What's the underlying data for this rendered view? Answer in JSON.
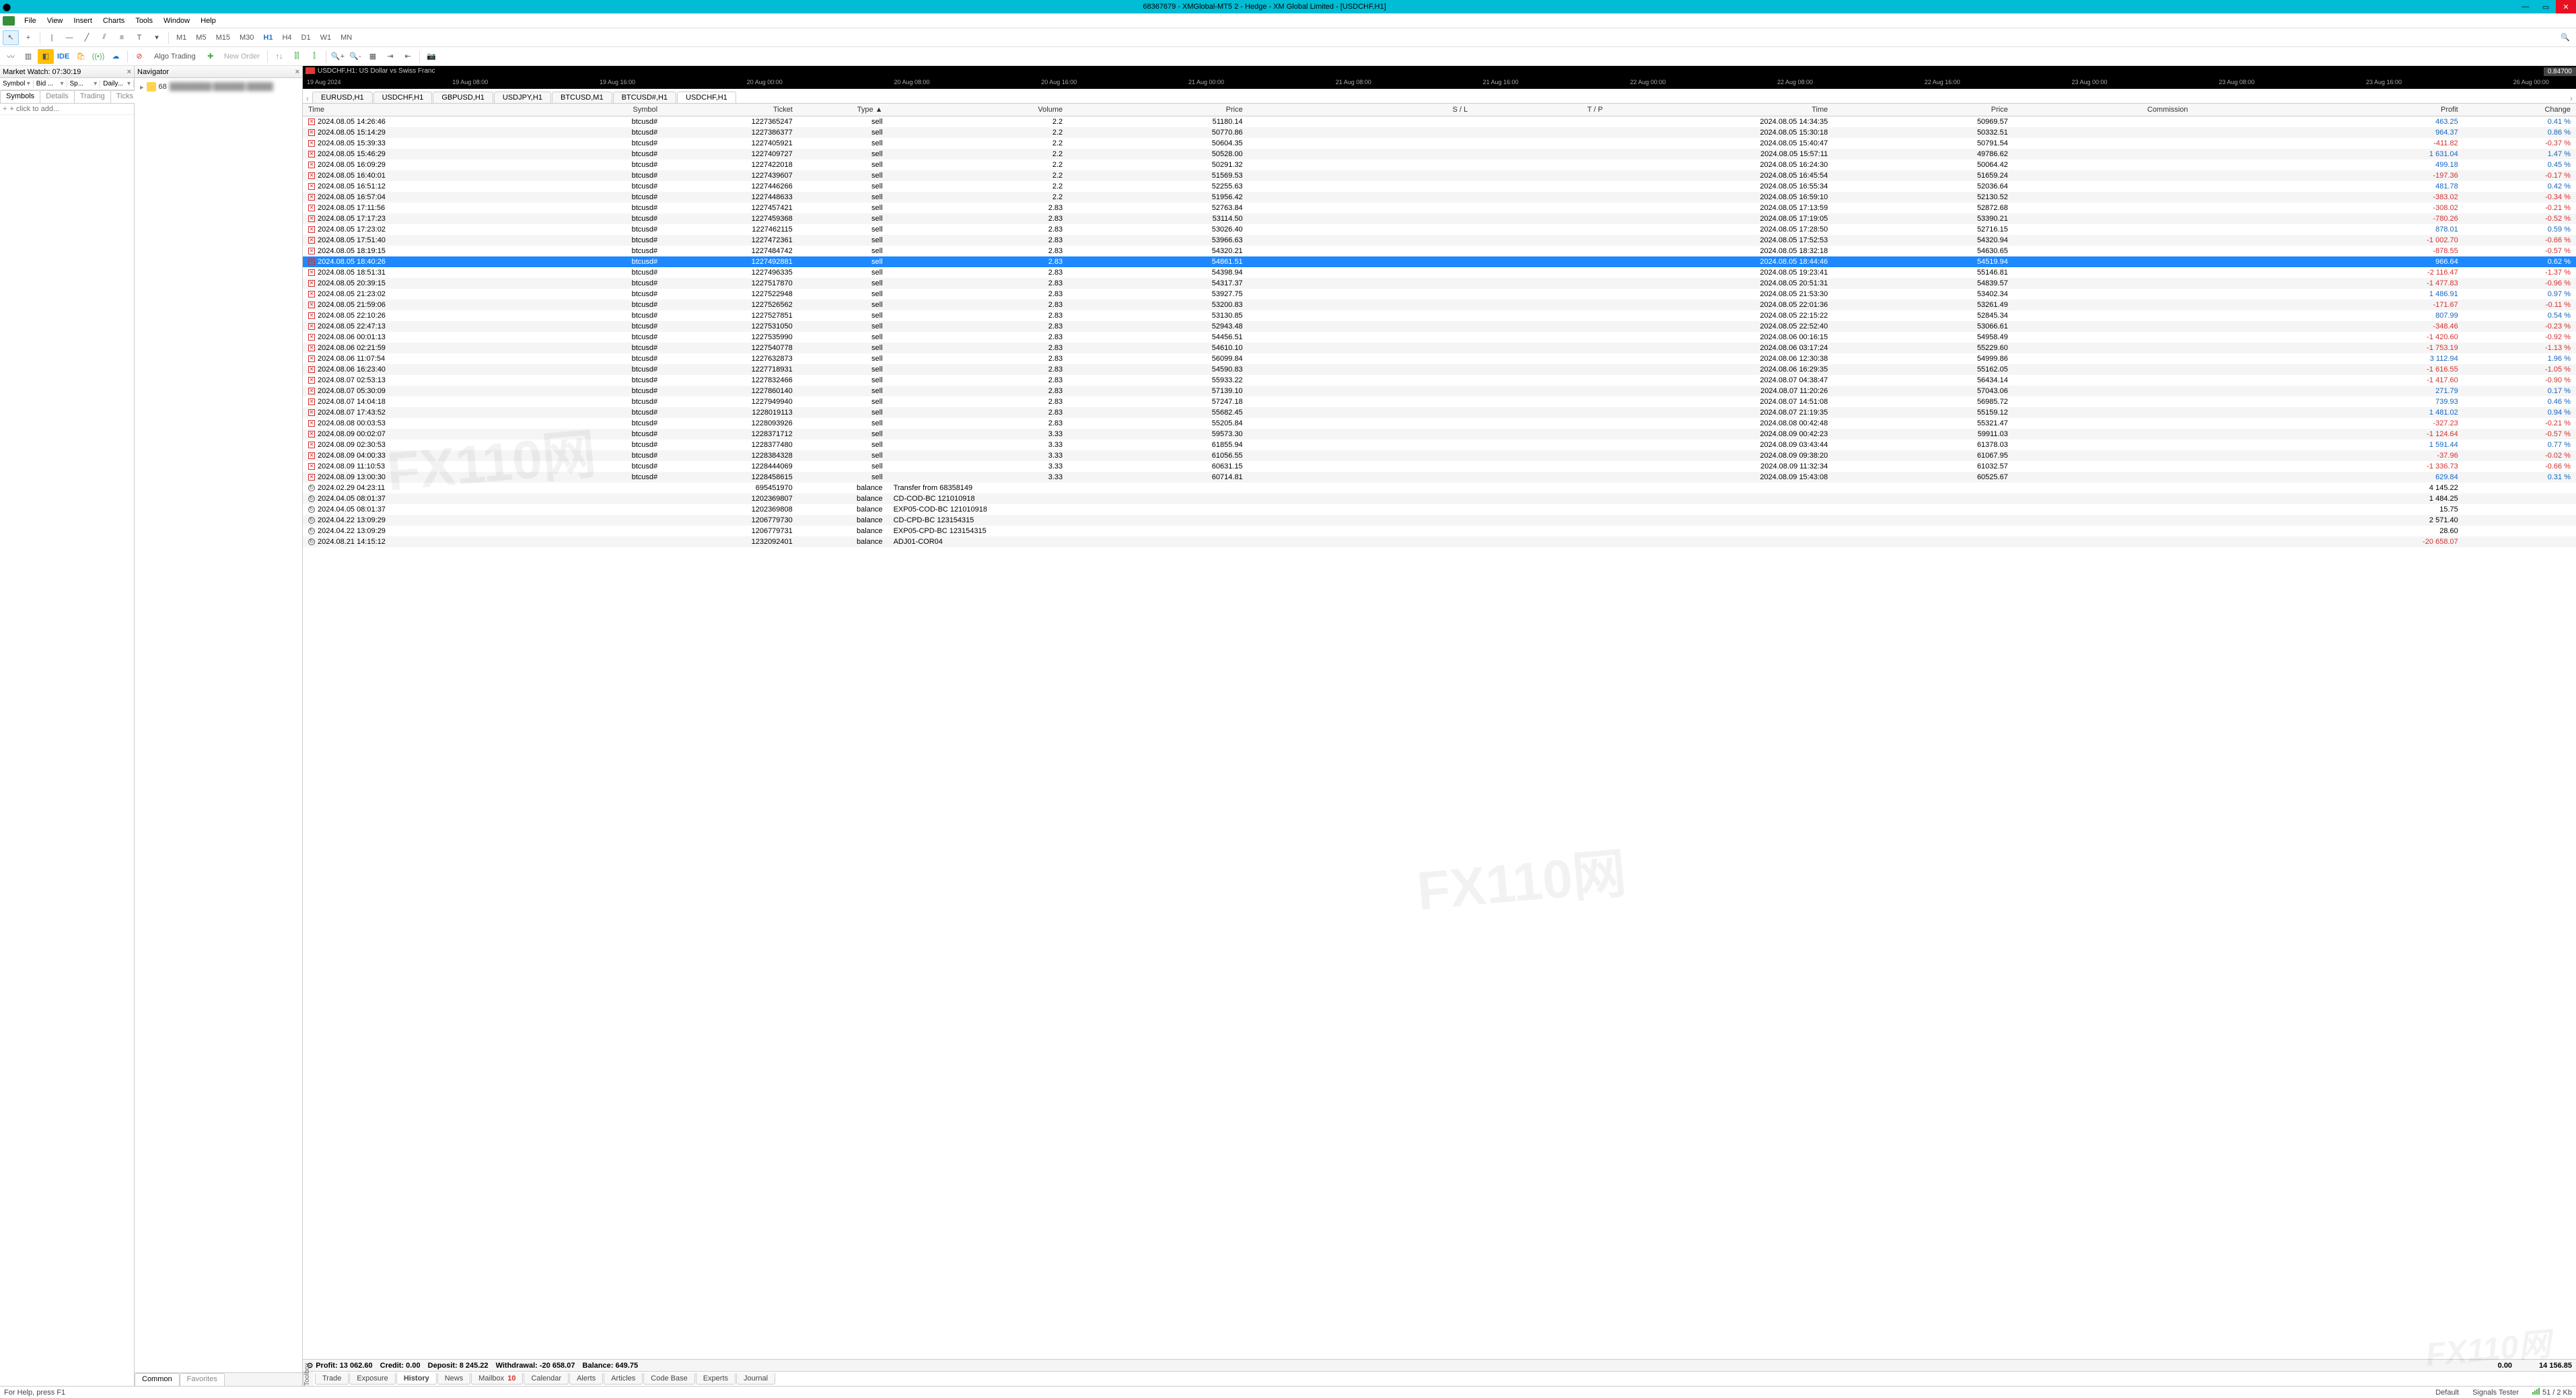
{
  "title": "68367679 - XMGlobal-MT5 2 - Hedge - XM Global Limited - [USDCHF,H1]",
  "menu": [
    "File",
    "View",
    "Insert",
    "Charts",
    "Tools",
    "Window",
    "Help"
  ],
  "timeframes": [
    "M1",
    "M5",
    "M15",
    "M30",
    "H1",
    "H4",
    "D1",
    "W1",
    "MN"
  ],
  "tf_active": "H1",
  "toolbar2": {
    "algo": "Algo Trading",
    "neworder": "New Order"
  },
  "market_watch": {
    "title": "Market Watch: 07:30:19",
    "filter_labels": [
      "Symbol",
      "Bid ...",
      "Sp...",
      "Daily..."
    ],
    "tabs": [
      "Symbols",
      "Details",
      "Trading",
      "Ticks"
    ],
    "search_placeholder": "+ click to add..."
  },
  "navigator": {
    "title": "Navigator",
    "account_id": "68",
    "account_name_masked": "████████ ██████ █████",
    "tabs": [
      "Common",
      "Favorites"
    ]
  },
  "chart": {
    "label": "USDCHF,H1: US Dollar vs Swiss Franc",
    "price": "0.84700",
    "ticks": [
      "19 Aug 2024",
      "19 Aug 08:00",
      "19 Aug 16:00",
      "20 Aug 00:00",
      "20 Aug 08:00",
      "20 Aug 16:00",
      "21 Aug 00:00",
      "21 Aug 08:00",
      "21 Aug 16:00",
      "22 Aug 00:00",
      "22 Aug 08:00",
      "22 Aug 16:00",
      "23 Aug 00:00",
      "23 Aug 08:00",
      "23 Aug 16:00",
      "26 Aug 00:00"
    ],
    "tabs": [
      "EURUSD,H1",
      "USDCHF,H1",
      "GBPUSD,H1",
      "USDJPY,H1",
      "BTCUSD,M1",
      "BTCUSD#,H1",
      "USDCHF,H1"
    ],
    "active_idx": 6
  },
  "headers": [
    "Time",
    "Symbol",
    "Ticket",
    "Type  ▲",
    "Volume",
    "Price",
    "S / L",
    "T / P",
    "Time",
    "Price",
    "Commission",
    "Profit",
    "Change"
  ],
  "rows": [
    {
      "t": "2024.08.05 14:26:46",
      "s": "btcusd#",
      "tk": "1227365247",
      "ty": "sell",
      "v": "2.2",
      "p": "51180.14",
      "sl": "",
      "tp": "",
      "t2": "2024.08.05 14:34:35",
      "p2": "50969.57",
      "c": "",
      "pr": "463.25",
      "ch": "0.41 %",
      "pc": "pos",
      "cc": "pos"
    },
    {
      "t": "2024.08.05 15:14:29",
      "s": "btcusd#",
      "tk": "1227386377",
      "ty": "sell",
      "v": "2.2",
      "p": "50770.86",
      "sl": "",
      "tp": "",
      "t2": "2024.08.05 15:30:18",
      "p2": "50332.51",
      "c": "",
      "pr": "964.37",
      "ch": "0.86 %",
      "pc": "pos",
      "cc": "pos"
    },
    {
      "t": "2024.08.05 15:39:33",
      "s": "btcusd#",
      "tk": "1227405921",
      "ty": "sell",
      "v": "2.2",
      "p": "50604.35",
      "sl": "",
      "tp": "",
      "t2": "2024.08.05 15:40:47",
      "p2": "50791.54",
      "c": "",
      "pr": "-411.82",
      "ch": "-0.37 %",
      "pc": "neg",
      "cc": "neg"
    },
    {
      "t": "2024.08.05 15:46:29",
      "s": "btcusd#",
      "tk": "1227409727",
      "ty": "sell",
      "v": "2.2",
      "p": "50528.00",
      "sl": "",
      "tp": "",
      "t2": "2024.08.05 15:57:11",
      "p2": "49786.62",
      "c": "",
      "pr": "1 631.04",
      "ch": "1.47 %",
      "pc": "pos",
      "cc": "pos"
    },
    {
      "t": "2024.08.05 16:09:29",
      "s": "btcusd#",
      "tk": "1227422018",
      "ty": "sell",
      "v": "2.2",
      "p": "50291.32",
      "sl": "",
      "tp": "",
      "t2": "2024.08.05 16:24:30",
      "p2": "50064.42",
      "c": "",
      "pr": "499.18",
      "ch": "0.45 %",
      "pc": "pos",
      "cc": "pos"
    },
    {
      "t": "2024.08.05 16:40:01",
      "s": "btcusd#",
      "tk": "1227439607",
      "ty": "sell",
      "v": "2.2",
      "p": "51569.53",
      "sl": "",
      "tp": "",
      "t2": "2024.08.05 16:45:54",
      "p2": "51659.24",
      "c": "",
      "pr": "-197.36",
      "ch": "-0.17 %",
      "pc": "neg",
      "cc": "neg"
    },
    {
      "t": "2024.08.05 16:51:12",
      "s": "btcusd#",
      "tk": "1227446266",
      "ty": "sell",
      "v": "2.2",
      "p": "52255.63",
      "sl": "",
      "tp": "",
      "t2": "2024.08.05 16:55:34",
      "p2": "52036.64",
      "c": "",
      "pr": "481.78",
      "ch": "0.42 %",
      "pc": "pos",
      "cc": "pos"
    },
    {
      "t": "2024.08.05 16:57:04",
      "s": "btcusd#",
      "tk": "1227448633",
      "ty": "sell",
      "v": "2.2",
      "p": "51956.42",
      "sl": "",
      "tp": "",
      "t2": "2024.08.05 16:59:10",
      "p2": "52130.52",
      "c": "",
      "pr": "-383.02",
      "ch": "-0.34 %",
      "pc": "neg",
      "cc": "neg"
    },
    {
      "t": "2024.08.05 17:11:56",
      "s": "btcusd#",
      "tk": "1227457421",
      "ty": "sell",
      "v": "2.83",
      "p": "52763.84",
      "sl": "",
      "tp": "",
      "t2": "2024.08.05 17:13:59",
      "p2": "52872.68",
      "c": "",
      "pr": "-308.02",
      "ch": "-0.21 %",
      "pc": "neg",
      "cc": "neg"
    },
    {
      "t": "2024.08.05 17:17:23",
      "s": "btcusd#",
      "tk": "1227459368",
      "ty": "sell",
      "v": "2.83",
      "p": "53114.50",
      "sl": "",
      "tp": "",
      "t2": "2024.08.05 17:19:05",
      "p2": "53390.21",
      "c": "",
      "pr": "-780.26",
      "ch": "-0.52 %",
      "pc": "neg",
      "cc": "neg"
    },
    {
      "t": "2024.08.05 17:23:02",
      "s": "btcusd#",
      "tk": "1227462115",
      "ty": "sell",
      "v": "2.83",
      "p": "53026.40",
      "sl": "",
      "tp": "",
      "t2": "2024.08.05 17:28:50",
      "p2": "52716.15",
      "c": "",
      "pr": "878.01",
      "ch": "0.59 %",
      "pc": "pos",
      "cc": "pos"
    },
    {
      "t": "2024.08.05 17:51:40",
      "s": "btcusd#",
      "tk": "1227472361",
      "ty": "sell",
      "v": "2.83",
      "p": "53966.63",
      "sl": "",
      "tp": "",
      "t2": "2024.08.05 17:52:53",
      "p2": "54320.94",
      "c": "",
      "pr": "-1 002.70",
      "ch": "-0.66 %",
      "pc": "neg",
      "cc": "neg"
    },
    {
      "t": "2024.08.05 18:19:15",
      "s": "btcusd#",
      "tk": "1227484742",
      "ty": "sell",
      "v": "2.83",
      "p": "54320.21",
      "sl": "",
      "tp": "",
      "t2": "2024.08.05 18:32:18",
      "p2": "54630.65",
      "c": "",
      "pr": "-878.55",
      "ch": "-0.57 %",
      "pc": "neg",
      "cc": "neg"
    },
    {
      "t": "2024.08.05 18:40:26",
      "s": "btcusd#",
      "tk": "1227492881",
      "ty": "sell",
      "v": "2.83",
      "p": "54861.51",
      "sl": "",
      "tp": "",
      "t2": "2024.08.05 18:44:46",
      "p2": "54519.94",
      "c": "",
      "pr": "966.64",
      "ch": "0.62 %",
      "pc": "pos",
      "cc": "pos",
      "sel": true
    },
    {
      "t": "2024.08.05 18:51:31",
      "s": "btcusd#",
      "tk": "1227496335",
      "ty": "sell",
      "v": "2.83",
      "p": "54398.94",
      "sl": "",
      "tp": "",
      "t2": "2024.08.05 19:23:41",
      "p2": "55146.81",
      "c": "",
      "pr": "-2 116.47",
      "ch": "-1.37 %",
      "pc": "neg",
      "cc": "neg"
    },
    {
      "t": "2024.08.05 20:39:15",
      "s": "btcusd#",
      "tk": "1227517870",
      "ty": "sell",
      "v": "2.83",
      "p": "54317.37",
      "sl": "",
      "tp": "",
      "t2": "2024.08.05 20:51:31",
      "p2": "54839.57",
      "c": "",
      "pr": "-1 477.83",
      "ch": "-0.96 %",
      "pc": "neg",
      "cc": "neg"
    },
    {
      "t": "2024.08.05 21:23:02",
      "s": "btcusd#",
      "tk": "1227522948",
      "ty": "sell",
      "v": "2.83",
      "p": "53927.75",
      "sl": "",
      "tp": "",
      "t2": "2024.08.05 21:53:30",
      "p2": "53402.34",
      "c": "",
      "pr": "1 486.91",
      "ch": "0.97 %",
      "pc": "pos",
      "cc": "pos"
    },
    {
      "t": "2024.08.05 21:59:06",
      "s": "btcusd#",
      "tk": "1227526562",
      "ty": "sell",
      "v": "2.83",
      "p": "53200.83",
      "sl": "",
      "tp": "",
      "t2": "2024.08.05 22:01:36",
      "p2": "53261.49",
      "c": "",
      "pr": "-171.67",
      "ch": "-0.11 %",
      "pc": "neg",
      "cc": "neg"
    },
    {
      "t": "2024.08.05 22:10:26",
      "s": "btcusd#",
      "tk": "1227527851",
      "ty": "sell",
      "v": "2.83",
      "p": "53130.85",
      "sl": "",
      "tp": "",
      "t2": "2024.08.05 22:15:22",
      "p2": "52845.34",
      "c": "",
      "pr": "807.99",
      "ch": "0.54 %",
      "pc": "pos",
      "cc": "pos"
    },
    {
      "t": "2024.08.05 22:47:13",
      "s": "btcusd#",
      "tk": "1227531050",
      "ty": "sell",
      "v": "2.83",
      "p": "52943.48",
      "sl": "",
      "tp": "",
      "t2": "2024.08.05 22:52:40",
      "p2": "53066.61",
      "c": "",
      "pr": "-348.46",
      "ch": "-0.23 %",
      "pc": "neg",
      "cc": "neg"
    },
    {
      "t": "2024.08.06 00:01:13",
      "s": "btcusd#",
      "tk": "1227535990",
      "ty": "sell",
      "v": "2.83",
      "p": "54456.51",
      "sl": "",
      "tp": "",
      "t2": "2024.08.06 00:16:15",
      "p2": "54958.49",
      "c": "",
      "pr": "-1 420.60",
      "ch": "-0.92 %",
      "pc": "neg",
      "cc": "neg"
    },
    {
      "t": "2024.08.06 02:21:59",
      "s": "btcusd#",
      "tk": "1227540778",
      "ty": "sell",
      "v": "2.83",
      "p": "54610.10",
      "sl": "",
      "tp": "",
      "t2": "2024.08.06 03:17:24",
      "p2": "55229.60",
      "c": "",
      "pr": "-1 753.19",
      "ch": "-1.13 %",
      "pc": "neg",
      "cc": "neg"
    },
    {
      "t": "2024.08.06 11:07:54",
      "s": "btcusd#",
      "tk": "1227632873",
      "ty": "sell",
      "v": "2.83",
      "p": "56099.84",
      "sl": "",
      "tp": "",
      "t2": "2024.08.06 12:30:38",
      "p2": "54999.86",
      "c": "",
      "pr": "3 112.94",
      "ch": "1.96 %",
      "pc": "pos",
      "cc": "pos"
    },
    {
      "t": "2024.08.06 16:23:40",
      "s": "btcusd#",
      "tk": "1227718931",
      "ty": "sell",
      "v": "2.83",
      "p": "54590.83",
      "sl": "",
      "tp": "",
      "t2": "2024.08.06 16:29:35",
      "p2": "55162.05",
      "c": "",
      "pr": "-1 616.55",
      "ch": "-1.05 %",
      "pc": "neg",
      "cc": "neg"
    },
    {
      "t": "2024.08.07 02:53:13",
      "s": "btcusd#",
      "tk": "1227832466",
      "ty": "sell",
      "v": "2.83",
      "p": "55933.22",
      "sl": "",
      "tp": "",
      "t2": "2024.08.07 04:38:47",
      "p2": "56434.14",
      "c": "",
      "pr": "-1 417.60",
      "ch": "-0.90 %",
      "pc": "neg",
      "cc": "neg"
    },
    {
      "t": "2024.08.07 05:30:09",
      "s": "btcusd#",
      "tk": "1227860140",
      "ty": "sell",
      "v": "2.83",
      "p": "57139.10",
      "sl": "",
      "tp": "",
      "t2": "2024.08.07 11:20:26",
      "p2": "57043.06",
      "c": "",
      "pr": "271.79",
      "ch": "0.17 %",
      "pc": "pos",
      "cc": "pos"
    },
    {
      "t": "2024.08.07 14:04:18",
      "s": "btcusd#",
      "tk": "1227949940",
      "ty": "sell",
      "v": "2.83",
      "p": "57247.18",
      "sl": "",
      "tp": "",
      "t2": "2024.08.07 14:51:08",
      "p2": "56985.72",
      "c": "",
      "pr": "739.93",
      "ch": "0.46 %",
      "pc": "pos",
      "cc": "pos"
    },
    {
      "t": "2024.08.07 17:43:52",
      "s": "btcusd#",
      "tk": "1228019113",
      "ty": "sell",
      "v": "2.83",
      "p": "55682.45",
      "sl": "",
      "tp": "",
      "t2": "2024.08.07 21:19:35",
      "p2": "55159.12",
      "c": "",
      "pr": "1 481.02",
      "ch": "0.94 %",
      "pc": "pos",
      "cc": "pos"
    },
    {
      "t": "2024.08.08 00:03:53",
      "s": "btcusd#",
      "tk": "1228093926",
      "ty": "sell",
      "v": "2.83",
      "p": "55205.84",
      "sl": "",
      "tp": "",
      "t2": "2024.08.08 00:42:48",
      "p2": "55321.47",
      "c": "",
      "pr": "-327.23",
      "ch": "-0.21 %",
      "pc": "neg",
      "cc": "neg"
    },
    {
      "t": "2024.08.09 00:02:07",
      "s": "btcusd#",
      "tk": "1228371712",
      "ty": "sell",
      "v": "3.33",
      "p": "59573.30",
      "sl": "",
      "tp": "",
      "t2": "2024.08.09 00:42:23",
      "p2": "59911.03",
      "c": "",
      "pr": "-1 124.64",
      "ch": "-0.57 %",
      "pc": "neg",
      "cc": "neg"
    },
    {
      "t": "2024.08.09 02:30:53",
      "s": "btcusd#",
      "tk": "1228377480",
      "ty": "sell",
      "v": "3.33",
      "p": "61855.94",
      "sl": "",
      "tp": "",
      "t2": "2024.08.09 03:43:44",
      "p2": "61378.03",
      "c": "",
      "pr": "1 591.44",
      "ch": "0.77 %",
      "pc": "pos",
      "cc": "pos"
    },
    {
      "t": "2024.08.09 04:00:33",
      "s": "btcusd#",
      "tk": "1228384328",
      "ty": "sell",
      "v": "3.33",
      "p": "61056.55",
      "sl": "",
      "tp": "",
      "t2": "2024.08.09 09:38:20",
      "p2": "61067.95",
      "c": "",
      "pr": "-37.96",
      "ch": "-0.02 %",
      "pc": "neg",
      "cc": "neg"
    },
    {
      "t": "2024.08.09 11:10:53",
      "s": "btcusd#",
      "tk": "1228444069",
      "ty": "sell",
      "v": "3.33",
      "p": "60631.15",
      "sl": "",
      "tp": "",
      "t2": "2024.08.09 11:32:34",
      "p2": "61032.57",
      "c": "",
      "pr": "-1 336.73",
      "ch": "-0.66 %",
      "pc": "neg",
      "cc": "neg"
    },
    {
      "t": "2024.08.09 13:00:30",
      "s": "btcusd#",
      "tk": "1228458615",
      "ty": "sell",
      "v": "3.33",
      "p": "60714.81",
      "sl": "",
      "tp": "",
      "t2": "2024.08.09 15:43:08",
      "p2": "60525.67",
      "c": "",
      "pr": "629.84",
      "ch": "0.31 %",
      "pc": "pos",
      "cc": "pos"
    },
    {
      "t": "2024.02.29 04:23:11",
      "s": "",
      "tk": "695451970",
      "ty": "balance",
      "cm": "Transfer from 68358149",
      "pr": "4 145.22",
      "bal": true
    },
    {
      "t": "2024.04.05 08:01:37",
      "s": "",
      "tk": "1202369807",
      "ty": "balance",
      "cm": "CD-COD-BC 121010918",
      "pr": "1 484.25",
      "bal": true
    },
    {
      "t": "2024.04.05 08:01:37",
      "s": "",
      "tk": "1202369808",
      "ty": "balance",
      "cm": "EXP05-COD-BC 121010918",
      "pr": "15.75",
      "bal": true
    },
    {
      "t": "2024.04.22 13:09:29",
      "s": "",
      "tk": "1206779730",
      "ty": "balance",
      "cm": "CD-CPD-BC 123154315",
      "pr": "2 571.40",
      "bal": true
    },
    {
      "t": "2024.04.22 13:09:29",
      "s": "",
      "tk": "1206779731",
      "ty": "balance",
      "cm": "EXP05-CPD-BC 123154315",
      "pr": "28.60",
      "bal": true
    },
    {
      "t": "2024.08.21 14:15:12",
      "s": "",
      "tk": "1232092401",
      "ty": "balance",
      "cm": "ADJ01-COR04",
      "pr": "-20 658.07",
      "bal": true,
      "pc": "neg"
    }
  ],
  "summary": {
    "profit": "Profit: 13 062.60",
    "credit": "Credit: 0.00",
    "deposit": "Deposit: 8 245.22",
    "withdrawal": "Withdrawal: -20 658.07",
    "balance": "Balance: 649.75",
    "commission": "0.00",
    "total_profit": "14 156.85"
  },
  "bottom_tabs": [
    {
      "l": "Trade"
    },
    {
      "l": "Exposure"
    },
    {
      "l": "History",
      "act": true
    },
    {
      "l": "News"
    },
    {
      "l": "Mailbox",
      "b": "10"
    },
    {
      "l": "Calendar"
    },
    {
      "l": "Alerts"
    },
    {
      "l": "Articles"
    },
    {
      "l": "Code Base"
    },
    {
      "l": "Experts"
    },
    {
      "l": "Journal"
    }
  ],
  "toolbox_label": "Toolbox",
  "status": {
    "help": "For Help, press F1",
    "default": "Default",
    "signals": "Signals Tester",
    "net": "51 / 2 Kb"
  }
}
